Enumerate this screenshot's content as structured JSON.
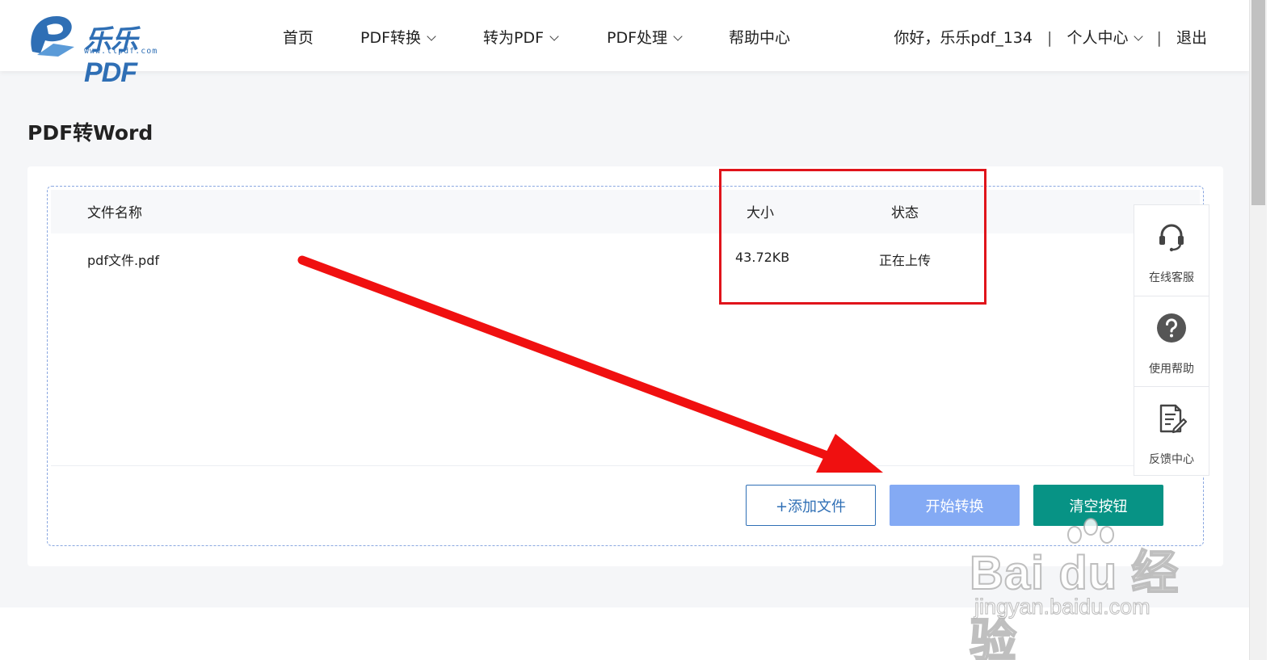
{
  "brand": {
    "name": "乐乐PDF",
    "url": "www.llpdf.com",
    "color": "#2f6fb5"
  },
  "nav": {
    "home": "首页",
    "convert": "PDF转换",
    "to_pdf": "转为PDF",
    "process": "PDF处理",
    "help": "帮助中心"
  },
  "user": {
    "greeting": "你好，乐乐pdf_134",
    "center": "个人中心",
    "logout": "退出"
  },
  "page": {
    "title": "PDF转Word"
  },
  "table": {
    "col_name": "文件名称",
    "col_size": "大小",
    "col_status": "状态",
    "rows": [
      {
        "name": "pdf文件.pdf",
        "size": "43.72KB",
        "status": "正在上传"
      }
    ]
  },
  "buttons": {
    "add": "+添加文件",
    "start": "开始转换",
    "clear": "清空按钮"
  },
  "side_panel": {
    "service": "在线客服",
    "help": "使用帮助",
    "feedback": "反馈中心"
  },
  "watermark": {
    "big": "Bai du 经验",
    "small": "jingyan.baidu.com"
  },
  "colors": {
    "accent_blue": "#2f6fb5",
    "start_button": "#84aaf4",
    "clear_button": "#079385",
    "highlight_red": "#e0141b"
  }
}
